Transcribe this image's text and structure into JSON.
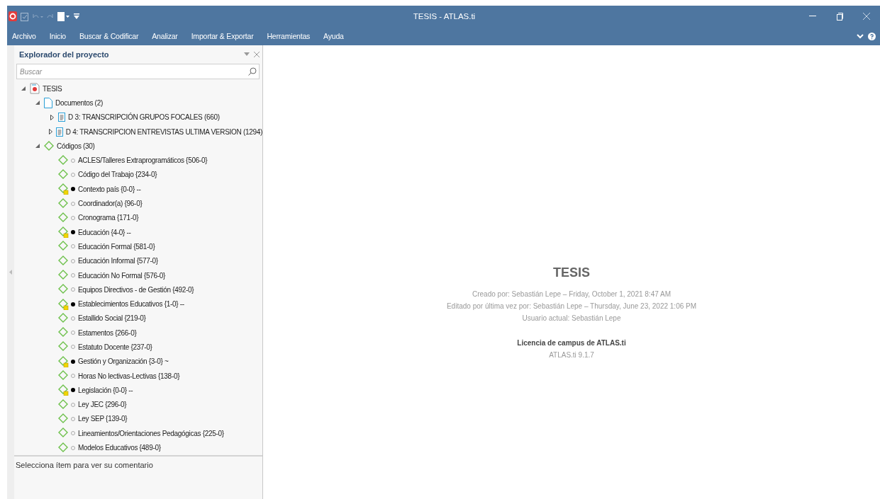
{
  "window": {
    "title": "TESIS - ATLAS.ti"
  },
  "menu": [
    {
      "label": "Archivo"
    },
    {
      "label": "Inicio"
    },
    {
      "label": "Buscar & Codificar"
    },
    {
      "label": "Analizar"
    },
    {
      "label": "Importar & Exportar"
    },
    {
      "label": "Herramientas"
    },
    {
      "label": "Ayuda"
    }
  ],
  "explorer": {
    "title": "Explorador del proyecto",
    "search": {
      "placeholder": "Buscar"
    },
    "tree": [
      {
        "kind": "project",
        "label": "TESIS",
        "expanded": true,
        "children": [
          {
            "kind": "folder",
            "label": "Documentos (2)",
            "expanded": true,
            "children": [
              {
                "kind": "document",
                "label": "D 3: TRANSCRIPCIÓN GRUPOS FOCALES (660)",
                "expanded": false
              },
              {
                "kind": "document",
                "label": "D 4: TRANSCRIPCION ENTREVISTAS ULTIMA VERSION (1294)",
                "expanded": false
              }
            ]
          },
          {
            "kind": "codes",
            "label": "Códigos (30)",
            "expanded": true,
            "children": [
              {
                "kind": "code",
                "label": "ACLES/Talleres Extraprogramáticos {506-0}",
                "comment": false
              },
              {
                "kind": "code",
                "label": "Código del Trabajo {234-0}",
                "comment": false
              },
              {
                "kind": "code",
                "label": "Contexto país {0-0} --",
                "comment": true
              },
              {
                "kind": "code",
                "label": "Coordinador(a) {96-0}",
                "comment": false
              },
              {
                "kind": "code",
                "label": "Cronograma {171-0}",
                "comment": false
              },
              {
                "kind": "code",
                "label": "Educación {4-0} --",
                "comment": true
              },
              {
                "kind": "code",
                "label": "Educación Formal {581-0}",
                "comment": false
              },
              {
                "kind": "code",
                "label": "Educación Informal {577-0}",
                "comment": false
              },
              {
                "kind": "code",
                "label": "Educación No Formal {576-0}",
                "comment": false
              },
              {
                "kind": "code",
                "label": "Equipos Directivos - de Gestión {492-0}",
                "comment": false
              },
              {
                "kind": "code",
                "label": "Establecimientos Educativos {1-0} --",
                "comment": true
              },
              {
                "kind": "code",
                "label": "Estallido Social {219-0}",
                "comment": false
              },
              {
                "kind": "code",
                "label": "Estamentos {266-0}",
                "comment": false
              },
              {
                "kind": "code",
                "label": "Estatuto Docente {237-0}",
                "comment": false
              },
              {
                "kind": "code",
                "label": "Gestión y Organización {3-0} ~",
                "comment": true
              },
              {
                "kind": "code",
                "label": "Horas No lectivas-Lectivas {138-0}",
                "comment": false
              },
              {
                "kind": "code",
                "label": "Legislación {0-0} --",
                "comment": true
              },
              {
                "kind": "code",
                "label": "Ley JEC {296-0}",
                "comment": false
              },
              {
                "kind": "code",
                "label": "Ley SEP {139-0}",
                "comment": false
              },
              {
                "kind": "code",
                "label": "Lineamientos/Orientaciones Pedagógicas {225-0}",
                "comment": false
              },
              {
                "kind": "code",
                "label": "Modelos Educativos {489-0}",
                "comment": false
              }
            ]
          }
        ]
      }
    ],
    "comment_hint": "Selecciona ítem para ver su comentario"
  },
  "project_info": {
    "name": "TESIS",
    "lines": [
      "Creado por: Sebastián Lepe – Friday, October 1, 2021 8:47 AM",
      "Editado por última vez por: Sebastián  Lepe – Thursday, June 23, 2022 1:06 PM",
      "Usuario actual: Sebastián  Lepe"
    ],
    "license": "Licencia de campus de ATLAS.ti",
    "version": "ATLAS.ti 9.1.7"
  }
}
